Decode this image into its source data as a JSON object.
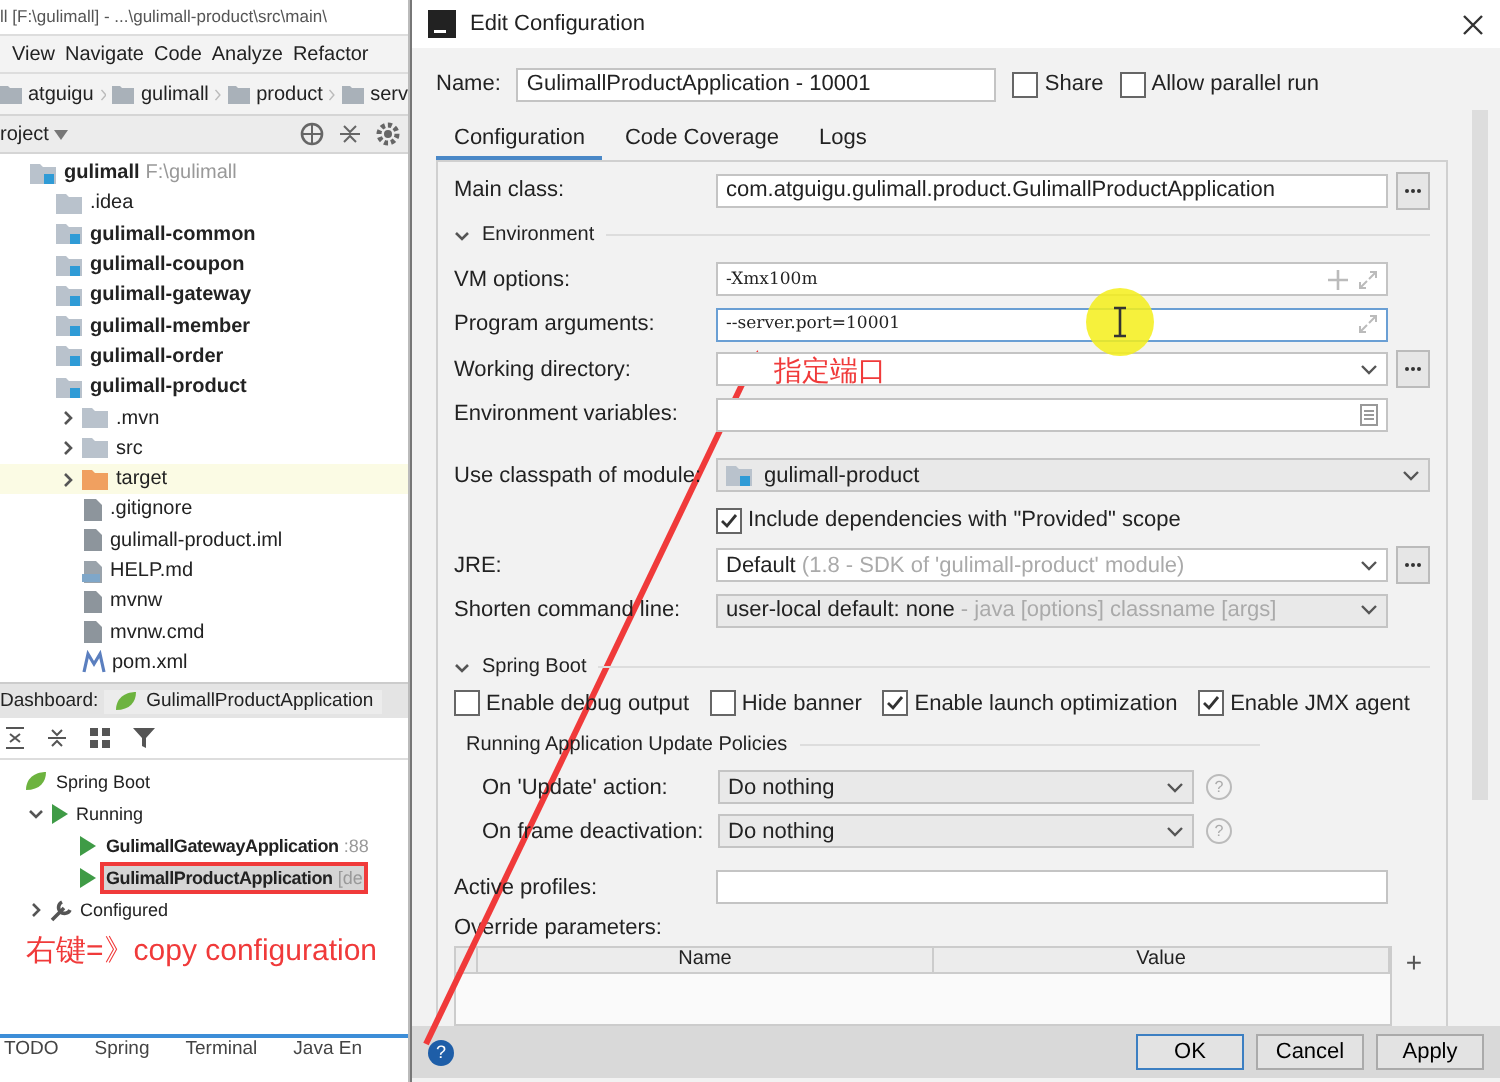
{
  "ide": {
    "title": "ll [F:\\gulimall] - ...\\gulimall-product\\src\\main\\",
    "menu": [
      "View",
      "Navigate",
      "Code",
      "Analyze",
      "Refactor"
    ],
    "breadcrumb": [
      "atguigu",
      "gulimall",
      "product",
      "serv"
    ],
    "project_header": "roject",
    "tree": [
      {
        "label": "gulimall",
        "hint": "F:\\gulimall",
        "kind": "module",
        "children": [
          {
            "label": ".idea",
            "kind": "folder"
          },
          {
            "label": "gulimall-common",
            "kind": "module"
          },
          {
            "label": "gulimall-coupon",
            "kind": "module"
          },
          {
            "label": "gulimall-gateway",
            "kind": "module"
          },
          {
            "label": "gulimall-member",
            "kind": "module"
          },
          {
            "label": "gulimall-order",
            "kind": "module"
          },
          {
            "label": "gulimall-product",
            "kind": "module",
            "children": [
              {
                "label": ".mvn",
                "kind": "folder",
                "expanded": false
              },
              {
                "label": "src",
                "kind": "folder",
                "expanded": false
              },
              {
                "label": "target",
                "kind": "excluded",
                "expanded": false
              },
              {
                "label": ".gitignore",
                "kind": "file"
              },
              {
                "label": "gulimall-product.iml",
                "kind": "file"
              },
              {
                "label": "HELP.md",
                "kind": "md"
              },
              {
                "label": "mvnw",
                "kind": "file"
              },
              {
                "label": "mvnw.cmd",
                "kind": "file"
              },
              {
                "label": "pom.xml",
                "kind": "maven"
              }
            ]
          }
        ]
      }
    ],
    "dashboard": {
      "label": "Dashboard:",
      "tab": "GulimallProductApplication",
      "tree": [
        {
          "label": "Spring Boot",
          "kind": "spring",
          "children": [
            {
              "label": "Running",
              "kind": "run",
              "expanded": true,
              "children": [
                {
                  "label": "GulimallGatewayApplication",
                  "hint": ":88",
                  "kind": "app",
                  "selected": false
                },
                {
                  "label": "GulimallProductApplication",
                  "hint": "[de",
                  "kind": "app",
                  "selected": true
                }
              ]
            },
            {
              "label": "Configured",
              "kind": "wrench",
              "expanded": false
            }
          ]
        }
      ]
    },
    "bottom_tabs": [
      "TODO",
      "Spring",
      "Terminal",
      "Java En"
    ]
  },
  "dialog": {
    "title": "Edit Configuration",
    "name_label": "Name:",
    "name_value": "GulimallProductApplication - 10001",
    "options": [
      {
        "label": "Share",
        "checked": false
      },
      {
        "label": "Allow parallel run",
        "checked": false
      }
    ],
    "tabs": [
      {
        "label": "Configuration",
        "selected": true
      },
      {
        "label": "Code Coverage",
        "selected": false
      },
      {
        "label": "Logs",
        "selected": false
      }
    ],
    "main_class": {
      "label": "Main class:",
      "value": "com.atguigu.gulimall.product.GulimallProductApplication"
    },
    "environment": {
      "title": "Environment",
      "expanded": true,
      "fields": [
        {
          "label": "VM options:",
          "value": "-Xmx100m",
          "kind": "expand",
          "focused": false
        },
        {
          "label": "Program arguments:",
          "value": "--server.port=10001",
          "kind": "expand",
          "focused": true
        },
        {
          "label": "Working directory:",
          "kind": "browse",
          "focused": false
        },
        {
          "label": "Environment variables:",
          "kind": "env",
          "focused": false
        }
      ]
    },
    "classpath": {
      "label": "Use classpath of module:",
      "value": "gulimall-product"
    },
    "include_provided": {
      "label": "Include dependencies with \"Provided\" scope",
      "checked": true
    },
    "jre": {
      "label": "JRE:",
      "value": "Default",
      "hint": "(1.8 - SDK of 'gulimall-product' module)"
    },
    "shorten": {
      "label": "Shorten command line:",
      "value": "user-local default: none",
      "hint": "- java [options] classname [args]"
    },
    "spring_boot": {
      "title": "Spring Boot",
      "expanded": true,
      "checks": [
        {
          "label": "Enable debug output",
          "checked": false
        },
        {
          "label": "Hide banner",
          "checked": false
        },
        {
          "label": "Enable launch optimization",
          "checked": true
        },
        {
          "label": "Enable JMX agent",
          "checked": true
        }
      ],
      "policies_title": "Running Application Update Policies",
      "policies": [
        {
          "label": "On 'Update' action:",
          "value": "Do nothing",
          "help": "?"
        },
        {
          "label": "On frame deactivation:",
          "value": "Do nothing",
          "help": "?"
        }
      ]
    },
    "active_profiles": {
      "label": "Active profiles:"
    },
    "override": {
      "label": "Override parameters:",
      "columns": [
        "Name",
        "Value"
      ],
      "add": "+"
    },
    "help": "?",
    "buttons": [
      {
        "label": "OK",
        "default": true
      },
      {
        "label": "Cancel",
        "default": false
      },
      {
        "label": "Apply",
        "default": false
      }
    ]
  },
  "annotations": {
    "arrow_note": "指定端口",
    "copy_note": "右键=》copy configuration"
  }
}
